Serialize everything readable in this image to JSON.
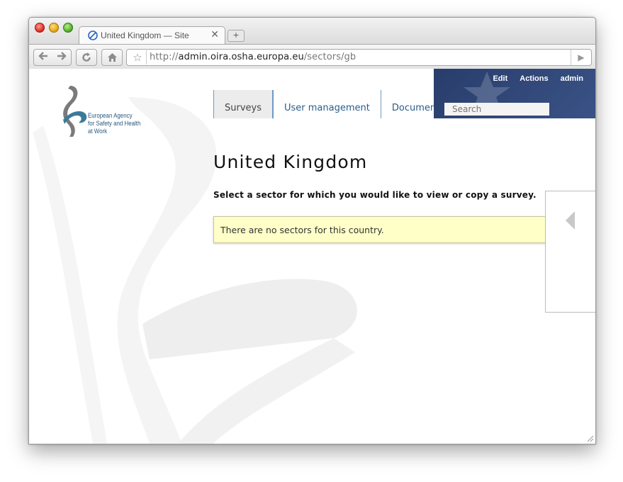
{
  "browser": {
    "tab_title": "United Kingdom — Site",
    "tab_close": "✕",
    "new_tab": "+",
    "url_prefix": "http://",
    "url_domain": "admin.oira.osha.europa.eu",
    "url_path": "/sectors/gb"
  },
  "logo": {
    "lines": [
      "European Agency",
      "for Safety and Health",
      "at Work"
    ]
  },
  "nav": {
    "items": [
      {
        "label": "Surveys",
        "active": true
      },
      {
        "label": "User management",
        "active": false
      },
      {
        "label": "Documents",
        "active": false
      }
    ]
  },
  "header": {
    "links": [
      "Edit",
      "Actions",
      "admin"
    ],
    "search_placeholder": "Search"
  },
  "main": {
    "title": "United Kingdom",
    "intro": "Select a sector for which you would like to view or copy a survey.",
    "notice": "There are no sectors for this country."
  },
  "icons": {
    "back": "back-arrow-icon",
    "forward": "forward-arrow-icon",
    "reload": "reload-icon",
    "home": "home-icon",
    "bookmark": "star-icon",
    "go": "play-icon",
    "side": "triangle-left-icon"
  },
  "colors": {
    "accent": "#2b5d88",
    "header_bg": "#2f4677",
    "notice_bg": "#ffffc7"
  }
}
